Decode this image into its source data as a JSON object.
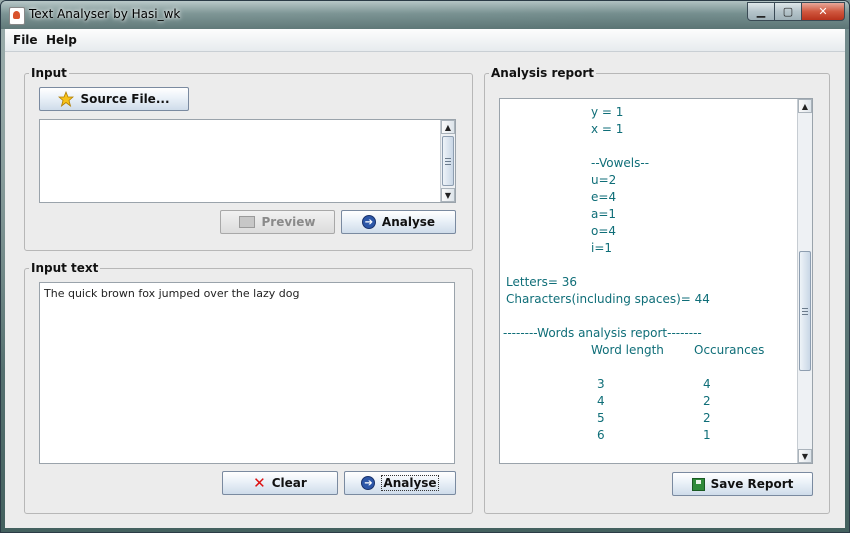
{
  "window": {
    "title": "Text Analyser by Hasi_wk"
  },
  "menu": {
    "items": [
      "File",
      "Help"
    ]
  },
  "input_panel": {
    "title": "Input",
    "source_button": "Source File...",
    "preview_button": "Preview",
    "analyse_button": "Analyse"
  },
  "input_text_panel": {
    "title": "Input text",
    "text": "The quick brown fox jumped over the lazy dog",
    "clear_button": "Clear",
    "analyse_button": "Analyse"
  },
  "report_panel": {
    "title": "Analysis report",
    "save_button": "Save Report",
    "lines": [
      "y = 1",
      "x = 1",
      "",
      "--Vowels--",
      "u=2",
      "e=4",
      "a=1",
      "o=4",
      "i=1",
      "",
      "Letters= 36",
      "Characters(including spaces)= 44",
      "",
      "--------Words analysis report--------",
      "Word length",
      "Occurances",
      "",
      "3",
      "4",
      "4",
      "2",
      "5",
      "2",
      "6",
      "1"
    ]
  },
  "icons": {
    "source": "star-icon",
    "preview": "preview-icon",
    "analyse": "arrow-circle-icon",
    "clear": "x-icon",
    "save": "save-icon"
  }
}
